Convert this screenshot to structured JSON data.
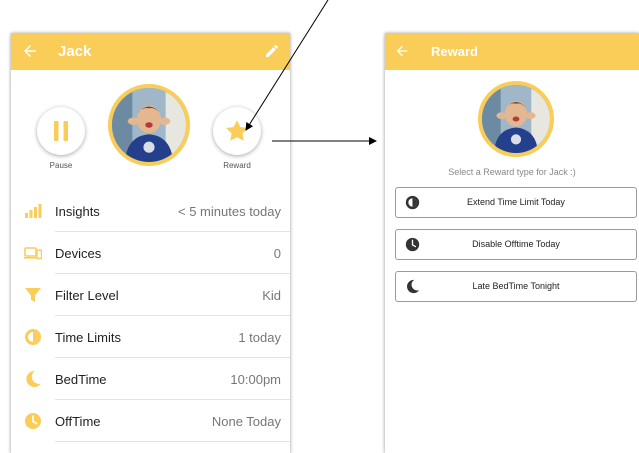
{
  "left": {
    "header": {
      "title": "Jack"
    },
    "actions": {
      "pause_label": "Pause",
      "reward_label": "Reward"
    },
    "rows": [
      {
        "icon": "insights-bars-icon",
        "label": "Insights",
        "value": "< 5 minutes today"
      },
      {
        "icon": "devices-icon",
        "label": "Devices",
        "value": "0"
      },
      {
        "icon": "filter-funnel-icon",
        "label": "Filter Level",
        "value": "Kid"
      },
      {
        "icon": "time-limit-clock-icon",
        "label": "Time Limits",
        "value": "1 today"
      },
      {
        "icon": "moon-icon",
        "label": "BedTime",
        "value": "10:00pm"
      },
      {
        "icon": "clock-icon",
        "label": "OffTime",
        "value": "None Today"
      }
    ]
  },
  "right": {
    "header": {
      "title": "Reward"
    },
    "subtitle": "Select a Reward type for Jack :)",
    "options": [
      {
        "icon": "time-limit-clock-icon",
        "label": "Extend Time Limit Today"
      },
      {
        "icon": "clock-icon",
        "label": "Disable Offtime Today"
      },
      {
        "icon": "moon-icon",
        "label": "Late BedTime Tonight"
      }
    ]
  },
  "colors": {
    "accent": "#f9cd57",
    "text": "#222222",
    "muted": "#777777"
  }
}
